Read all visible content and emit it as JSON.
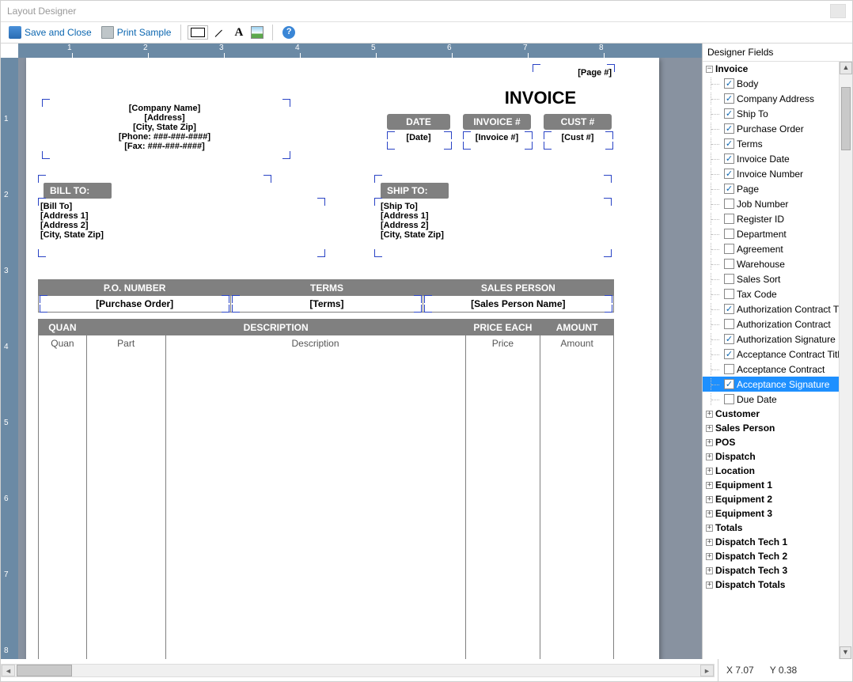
{
  "window": {
    "title": "Layout Designer"
  },
  "toolbar": {
    "save": "Save and Close",
    "print": "Print Sample"
  },
  "ruler": {
    "h": [
      "1",
      "2",
      "3",
      "4",
      "5",
      "6",
      "7",
      "8"
    ],
    "v": [
      "1",
      "2",
      "3",
      "4",
      "5",
      "6",
      "7",
      "8"
    ]
  },
  "invoice": {
    "title": "INVOICE",
    "page": "[Page #]",
    "company": {
      "name": "[Company Name]",
      "address": "[Address]",
      "csz": "[City, State Zip]",
      "phone": "[Phone: ###-###-####]",
      "fax": "[Fax: ###-###-####]"
    },
    "pills": {
      "date": "DATE",
      "invnum": "INVOICE #",
      "cust": "CUST #"
    },
    "vals": {
      "date": "[Date]",
      "invnum": "[Invoice #]",
      "cust": "[Cust #]"
    },
    "billto": {
      "label": "BILL TO:",
      "l1": "[Bill To]",
      "l2": "[Address 1]",
      "l3": "[Address 2]",
      "l4": "[City, State Zip]"
    },
    "shipto": {
      "label": "SHIP TO:",
      "l1": "[Ship To]",
      "l2": "[Address 1]",
      "l3": "[Address 2]",
      "l4": "[City, State Zip]"
    },
    "t1": {
      "h1": "P.O. NUMBER",
      "h2": "TERMS",
      "h3": "SALES PERSON",
      "v1": "[Purchase Order]",
      "v2": "[Terms]",
      "v3": "[Sales Person Name]"
    },
    "t2": {
      "h1": "QUAN",
      "h2": "DESCRIPTION",
      "h3": "PRICE EACH",
      "h4": "AMOUNT",
      "s1": "Quan",
      "s2": "Part",
      "s3": "Description",
      "s4": "Price",
      "s5": "Amount"
    }
  },
  "side": {
    "title": "Designer Fields",
    "root": "Invoice",
    "items": [
      {
        "label": "Body",
        "checked": true
      },
      {
        "label": "Company Address",
        "checked": true
      },
      {
        "label": "Ship To",
        "checked": true
      },
      {
        "label": "Purchase Order",
        "checked": true
      },
      {
        "label": "Terms",
        "checked": true
      },
      {
        "label": "Invoice Date",
        "checked": true
      },
      {
        "label": "Invoice Number",
        "checked": true
      },
      {
        "label": "Page",
        "checked": true
      },
      {
        "label": "Job Number",
        "checked": false
      },
      {
        "label": "Register ID",
        "checked": false
      },
      {
        "label": "Department",
        "checked": false
      },
      {
        "label": "Agreement",
        "checked": false
      },
      {
        "label": "Warehouse",
        "checked": false
      },
      {
        "label": "Sales Sort",
        "checked": false
      },
      {
        "label": "Tax Code",
        "checked": false
      },
      {
        "label": "Authorization Contract Title",
        "checked": true
      },
      {
        "label": "Authorization Contract",
        "checked": false
      },
      {
        "label": "Authorization Signature",
        "checked": true
      },
      {
        "label": "Acceptance Contract Title",
        "checked": true
      },
      {
        "label": "Acceptance Contract",
        "checked": false
      },
      {
        "label": "Acceptance Signature",
        "checked": true,
        "selected": true
      },
      {
        "label": "Due Date",
        "checked": false
      }
    ],
    "cats": [
      "Customer",
      "Sales Person",
      "POS",
      "Dispatch",
      "Location",
      "Equipment 1",
      "Equipment 2",
      "Equipment 3",
      "Totals",
      "Dispatch Tech 1",
      "Dispatch Tech 2",
      "Dispatch Tech 3",
      "Dispatch Totals"
    ]
  },
  "status": {
    "x": "X 7.07",
    "y": "Y  0.38"
  }
}
